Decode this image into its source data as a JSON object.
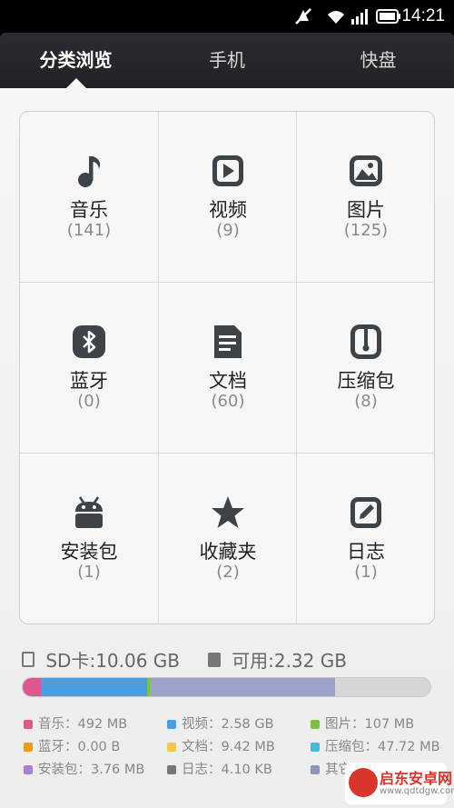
{
  "status_bar": {
    "time": "14:21",
    "icons": [
      "mute-icon",
      "wifi-icon",
      "signal-icon",
      "battery-icon"
    ]
  },
  "tabs": [
    {
      "label": "分类浏览",
      "active": true
    },
    {
      "label": "手机",
      "active": false
    },
    {
      "label": "快盘",
      "active": false
    }
  ],
  "categories": [
    {
      "label": "音乐",
      "count": "(141)",
      "icon": "music-note-icon"
    },
    {
      "label": "视频",
      "count": "(9)",
      "icon": "video-play-icon"
    },
    {
      "label": "图片",
      "count": "(125)",
      "icon": "picture-icon"
    },
    {
      "label": "蓝牙",
      "count": "(0)",
      "icon": "bluetooth-icon"
    },
    {
      "label": "文档",
      "count": "(60)",
      "icon": "document-icon"
    },
    {
      "label": "压缩包",
      "count": "(8)",
      "icon": "zip-archive-icon"
    },
    {
      "label": "安装包",
      "count": "(1)",
      "icon": "android-apk-icon"
    },
    {
      "label": "收藏夹",
      "count": "(2)",
      "icon": "star-icon"
    },
    {
      "label": "日志",
      "count": "(1)",
      "icon": "edit-log-icon"
    }
  ],
  "storage": {
    "sd_label": "SD卡:10.06 GB",
    "available_label": "可用:2.32 GB",
    "usage_fractions": [
      {
        "name": "音乐",
        "fraction": 0.044,
        "color": "#e0578f"
      },
      {
        "name": "视频",
        "fraction": 0.262,
        "color": "#4a9ee0"
      },
      {
        "name": "图片",
        "fraction": 0.006,
        "color": "#7ac143"
      },
      {
        "name": "其它",
        "fraction": 0.455,
        "color": "#9aa3c8"
      },
      {
        "name": "可用",
        "fraction": 0.233,
        "color": "#d6d6d6"
      }
    ]
  },
  "legend": [
    {
      "text": "音乐：492 MB",
      "color": "#e0578f"
    },
    {
      "text": "视频：2.58 GB",
      "color": "#4a9ee0"
    },
    {
      "text": "图片：107 MB",
      "color": "#7ac143"
    },
    {
      "text": "蓝牙：0.00 B",
      "color": "#f39c12"
    },
    {
      "text": "文档：9.42 MB",
      "color": "#f2c94c"
    },
    {
      "text": "压缩包：47.72 MB",
      "color": "#48b8d6"
    },
    {
      "text": "安装包：3.76 MB",
      "color": "#a682d4"
    },
    {
      "text": "日志：4.10 KB",
      "color": "#777777"
    },
    {
      "text": "其它",
      "color": "#8e95b8"
    }
  ],
  "watermark": {
    "title": "启东安卓网",
    "url": "www.qdtdgw.com"
  }
}
